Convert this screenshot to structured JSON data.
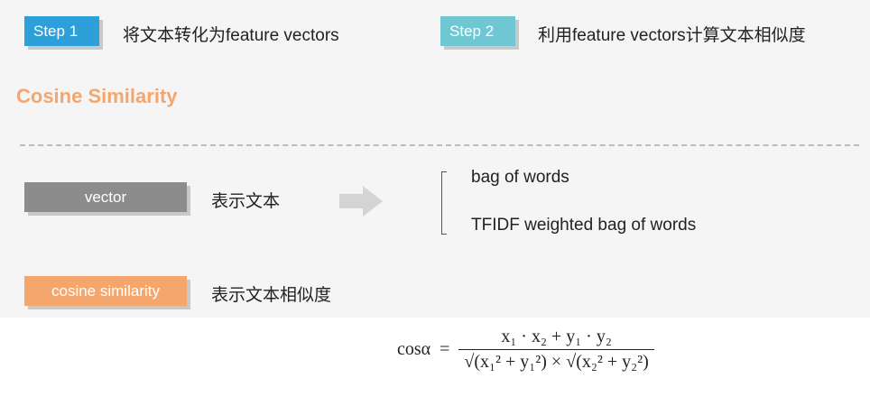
{
  "steps": [
    {
      "badge": "Step 1",
      "text": "将文本转化为feature vectors",
      "color": "#2d9fd9"
    },
    {
      "badge": "Step 2",
      "text": "利用feature vectors计算文本相似度",
      "color": "#6ec7d2"
    }
  ],
  "title": "Cosine Similarity",
  "rows": [
    {
      "badge": "vector",
      "text": "表示文本",
      "color": "#8c8c8c"
    },
    {
      "badge": "cosine similarity",
      "text": "表示文本相似度",
      "color": "#f4a66c"
    }
  ],
  "options": [
    "bag of words",
    "TFIDF weighted bag of words"
  ],
  "arrow_icon": "arrow-right-icon",
  "formula": {
    "lhs": "cosα",
    "eq": "=",
    "numerator": "x₁ · x₂ + y₁ · y₂",
    "denominator": "√(x₁² + y₁²) × √(x₂² + y₂²)"
  }
}
